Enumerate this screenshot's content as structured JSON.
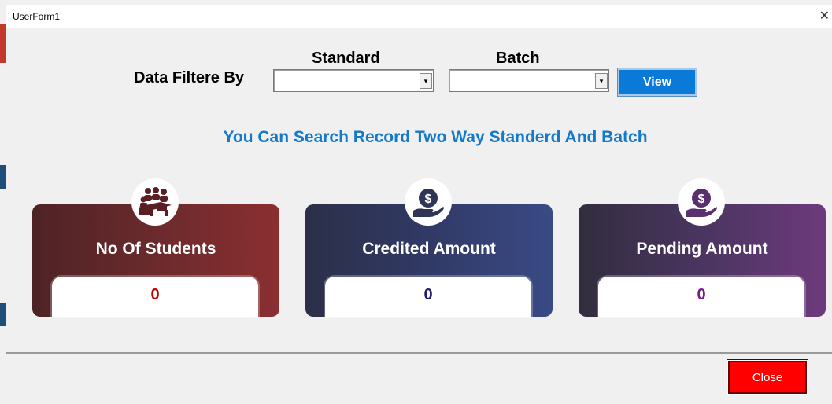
{
  "window": {
    "title": "UserForm1",
    "close_glyph": "✕"
  },
  "filter": {
    "label": "Data Filtere By",
    "standard_caption": "Standard",
    "batch_caption": "Batch",
    "standard_value": "",
    "batch_value": "",
    "dropdown_arrow": "▾",
    "view_label": "View"
  },
  "info_text": "You Can Search Record Two Way Standerd And Batch",
  "cards": [
    {
      "title": "No Of Students",
      "value": "0",
      "icon": "students-icon",
      "value_color": "#c00000"
    },
    {
      "title": "Credited Amount",
      "value": "0",
      "icon": "money-hand-icon",
      "value_color": "#1f1f6e"
    },
    {
      "title": "Pending Amount",
      "value": "0",
      "icon": "money-hand-icon",
      "value_color": "#7a1a8a"
    }
  ],
  "footer": {
    "close_label": "Close"
  },
  "colors": {
    "view_button": "#0a7ad8",
    "close_button": "#ff0000",
    "info_text": "#1579c9"
  }
}
